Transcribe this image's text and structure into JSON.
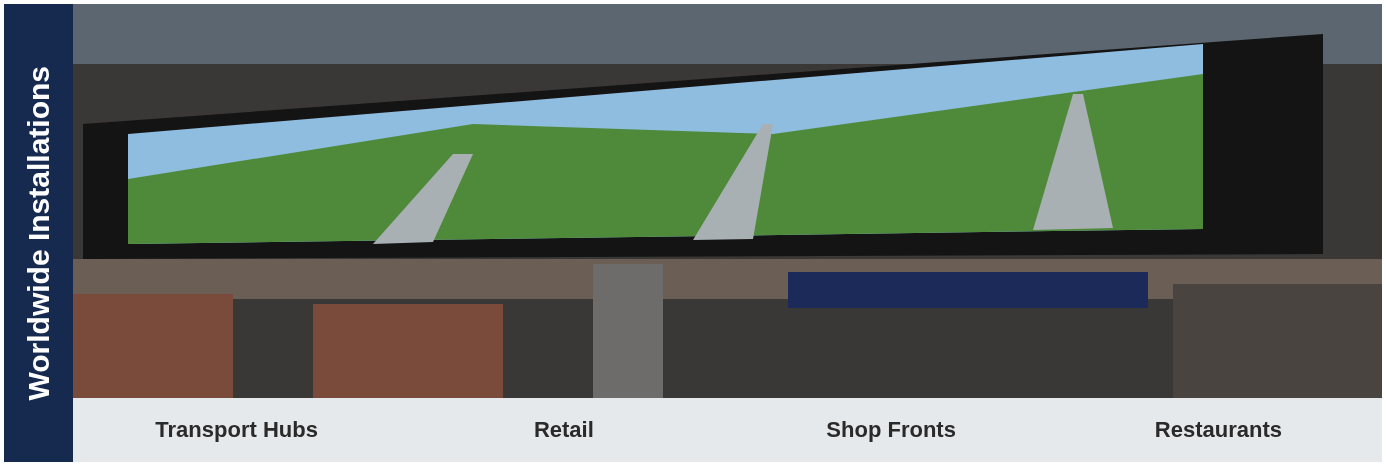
{
  "sidebar": {
    "title": "Worldwide Installations"
  },
  "categories": [
    {
      "label": "Transport Hubs"
    },
    {
      "label": "Retail"
    },
    {
      "label": "Shop Fronts"
    },
    {
      "label": "Restaurants"
    }
  ]
}
